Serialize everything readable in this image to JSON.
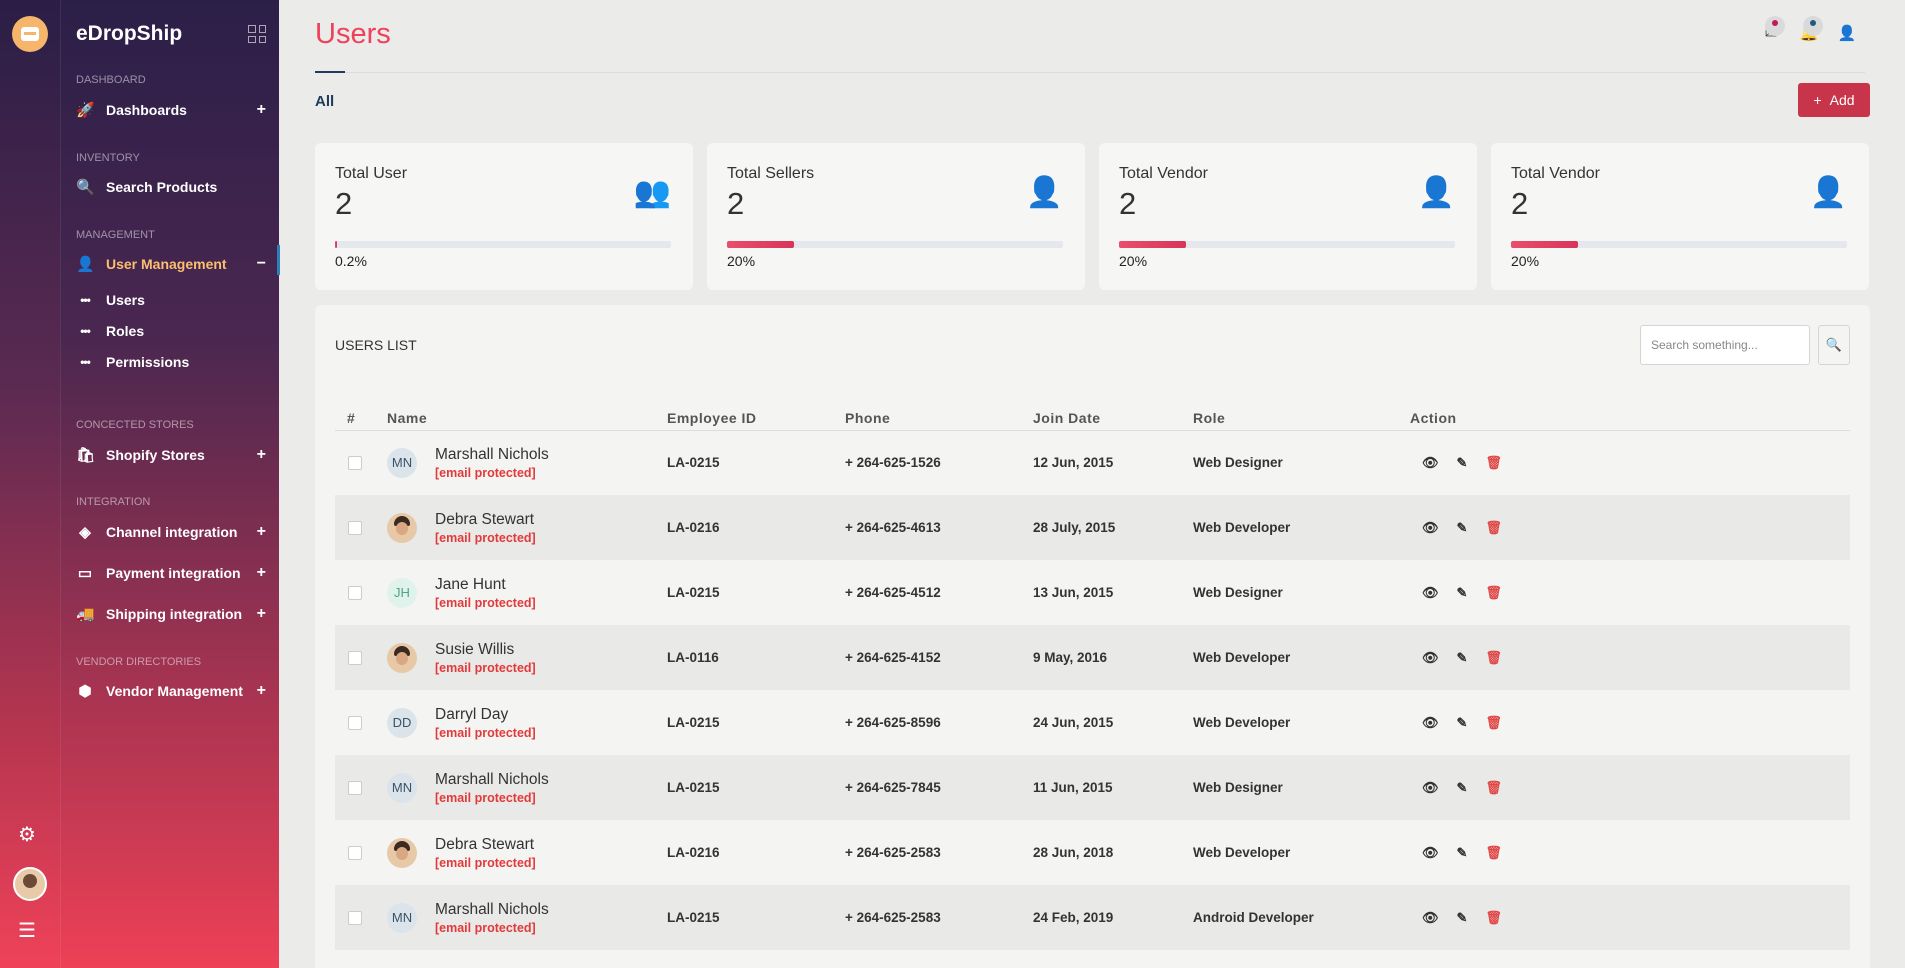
{
  "app": {
    "brand": "eDropShip"
  },
  "sidebar": {
    "sections": {
      "dashboard": "DASHBOARD",
      "inventory": "INVENTORY",
      "management": "MANAGEMENT",
      "stores": "CONCECTED STORES",
      "integration": "INTEGRATION",
      "vendor": "VENDOR DIRECTORIES"
    },
    "items": {
      "dashboards": "Dashboards",
      "search_products": "Search Products",
      "user_management": "User Management",
      "users": "Users",
      "roles": "Roles",
      "permissions": "Permissions",
      "shopify": "Shopify Stores",
      "channel": "Channel integration",
      "payment": "Payment integration",
      "shipping": "Shipping integration",
      "vendor_management": "Vendor Management"
    },
    "expand_symbol": "+",
    "collapse_symbol": "−"
  },
  "header": {
    "title": "Users",
    "tab_all": "All",
    "add_label": "Add",
    "notification_colors": {
      "mail": "#c2185b",
      "bell": "#1f5b7a"
    }
  },
  "stats": [
    {
      "label": "Total User",
      "value": "2",
      "percent": "0.2%",
      "fill": 0.002,
      "icon": "users-icon"
    },
    {
      "label": "Total Sellers",
      "value": "2",
      "percent": "20%",
      "fill": 0.2,
      "icon": "user-icon"
    },
    {
      "label": "Total Vendor",
      "value": "2",
      "percent": "20%",
      "fill": 0.2,
      "icon": "user-icon"
    },
    {
      "label": "Total Vendor",
      "value": "2",
      "percent": "20%",
      "fill": 0.2,
      "icon": "user-icon"
    }
  ],
  "users_list": {
    "title": "USERS LIST",
    "search_placeholder": "Search something...",
    "columns": [
      "#",
      "Name",
      "Employee ID",
      "Phone",
      "Join Date",
      "Role",
      "Action"
    ],
    "rows": [
      {
        "avatar": "MN",
        "avatar_type": "initials",
        "name": "Marshall Nichols",
        "email": "[email protected]",
        "employee_id": "LA-0215",
        "phone": "+ 264-625-1526",
        "join_date": "12 Jun, 2015",
        "role": "Web Designer"
      },
      {
        "avatar": "",
        "avatar_type": "photo",
        "name": "Debra Stewart",
        "email": "[email protected]",
        "employee_id": "LA-0216",
        "phone": "+ 264-625-4613",
        "join_date": "28 July, 2015",
        "role": "Web Developer"
      },
      {
        "avatar": "JH",
        "avatar_type": "initials-green",
        "name": "Jane Hunt",
        "email": "[email protected]",
        "employee_id": "LA-0215",
        "phone": "+ 264-625-4512",
        "join_date": "13 Jun, 2015",
        "role": "Web Designer"
      },
      {
        "avatar": "",
        "avatar_type": "photo",
        "name": "Susie Willis",
        "email": "[email protected]",
        "employee_id": "LA-0116",
        "phone": "+ 264-625-4152",
        "join_date": "9 May, 2016",
        "role": "Web Developer"
      },
      {
        "avatar": "DD",
        "avatar_type": "initials",
        "name": "Darryl Day",
        "email": "[email protected]",
        "employee_id": "LA-0215",
        "phone": "+ 264-625-8596",
        "join_date": "24 Jun, 2015",
        "role": "Web Developer"
      },
      {
        "avatar": "MN",
        "avatar_type": "initials",
        "name": "Marshall Nichols",
        "email": "[email protected]",
        "employee_id": "LA-0215",
        "phone": "+ 264-625-7845",
        "join_date": "11 Jun, 2015",
        "role": "Web Designer"
      },
      {
        "avatar": "",
        "avatar_type": "photo",
        "name": "Debra Stewart",
        "email": "[email protected]",
        "employee_id": "LA-0216",
        "phone": "+ 264-625-2583",
        "join_date": "28 Jun, 2018",
        "role": "Web Developer"
      },
      {
        "avatar": "MN",
        "avatar_type": "initials",
        "name": "Marshall Nichols",
        "email": "[email protected]",
        "employee_id": "LA-0215",
        "phone": "+ 264-625-2583",
        "join_date": "24 Feb, 2019",
        "role": "Android Developer"
      }
    ]
  }
}
